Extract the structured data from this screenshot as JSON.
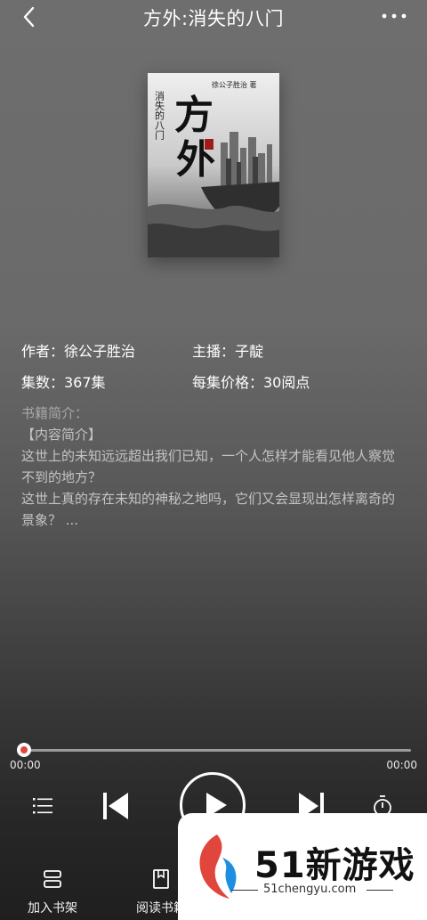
{
  "header": {
    "title": "方外:消失的八门"
  },
  "cover": {
    "title_big": "方外",
    "subtitle_vertical": "消失的八门",
    "author_vertical": "徐公子胜治 著"
  },
  "meta": {
    "author": "作者：徐公子胜治",
    "narrator": "主播：子靛",
    "episodes": "集数：367集",
    "price": "每集价格：30阅点"
  },
  "intro": {
    "heading": "书籍简介：",
    "section": "【内容简介】",
    "line1": "这世上的未知远远超出我们已知，一个人怎样才能看见他人察觉不到的地方？",
    "line2": "这世上真的存在未知的神秘之地吗，它们又会显现出怎样离奇的景象？ ..."
  },
  "player": {
    "elapsed": "00:00",
    "duration": "00:00",
    "progress": 0
  },
  "bottom": {
    "add_shelf": "加入书架",
    "read_book": "阅读书籍"
  },
  "watermark": {
    "name": "51新游戏",
    "url": "51chengyu.com"
  },
  "colors": {
    "accent": "#e0463b",
    "watermark_blue": "#1e8fe0"
  },
  "icons": [
    "back-arrow-icon",
    "more-dots-icon",
    "playlist-icon",
    "previous-icon",
    "play-icon",
    "next-icon",
    "timer-icon",
    "bookshelf-icon",
    "book-icon"
  ]
}
